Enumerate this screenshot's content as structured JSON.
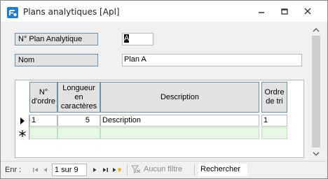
{
  "window": {
    "title": "Plans analytiques [Apl]",
    "accent": "#1e7fd1"
  },
  "form": {
    "plan_label": "N° Plan Analytique",
    "plan_value": "A",
    "nom_label": "Nom",
    "nom_value": "Plan A"
  },
  "grid": {
    "columns": [
      {
        "label": "N° d'ordre"
      },
      {
        "label": "Longueur en caractères"
      },
      {
        "label": "Description"
      },
      {
        "label": "Ordre de tri"
      }
    ],
    "rows": [
      {
        "ordre": "1",
        "longueur": "5",
        "description": "Description",
        "tri": "1"
      }
    ],
    "new_row_bg": "#e6f8e4"
  },
  "nav": {
    "label": "Enr :",
    "record": "1 sur 9",
    "filter": "Aucun filtre",
    "search": "Rechercher"
  },
  "icons": {
    "app": "access-form-icon",
    "current_record": "record-selector-arrow-icon",
    "new_record": "new-record-asterisk-icon"
  }
}
